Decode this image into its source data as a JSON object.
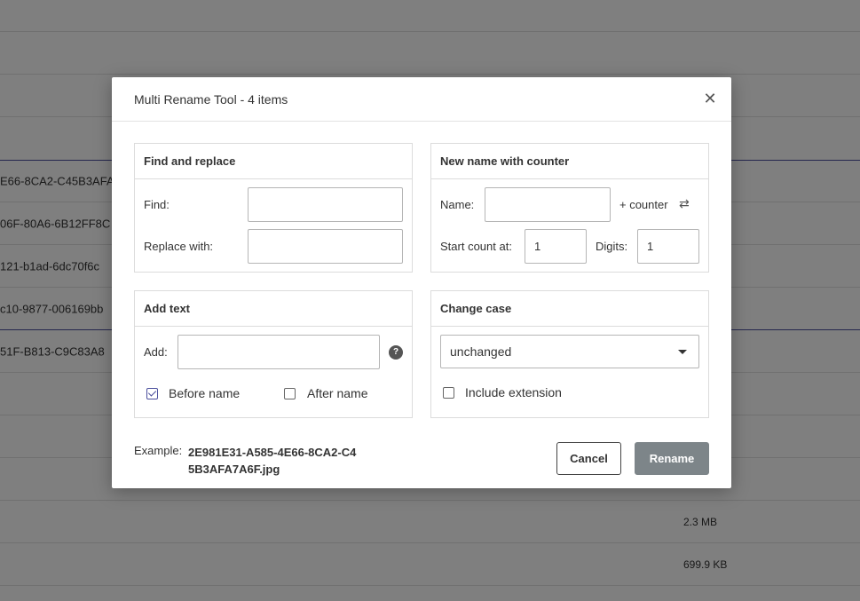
{
  "background": {
    "rows": [
      {
        "name": "",
        "size": ""
      },
      {
        "name": "",
        "size": ""
      },
      {
        "name": "",
        "size": ""
      },
      {
        "name": "E66-8CA2-C45B3AFA",
        "size": ""
      },
      {
        "name": "06F-80A6-6B12FF8C",
        "size": ""
      },
      {
        "name": "121-b1ad-6dc70f6c",
        "size": ""
      },
      {
        "name": "c10-9877-006169bb",
        "size": ""
      },
      {
        "name": "51F-B813-C9C83A8",
        "size": ""
      },
      {
        "name": "",
        "size": ""
      },
      {
        "name": "",
        "size": ""
      },
      {
        "name": "",
        "size": ""
      },
      {
        "name": "",
        "size": "2.3 MB"
      },
      {
        "name": "",
        "size": "699.9 KB"
      }
    ]
  },
  "dialog": {
    "title": "Multi Rename Tool - 4 items",
    "close_icon": "close-icon",
    "find_replace": {
      "heading": "Find and replace",
      "find_label": "Find:",
      "find_value": "",
      "replace_label": "Replace with:",
      "replace_value": ""
    },
    "counter": {
      "heading": "New name with counter",
      "name_label": "Name:",
      "name_value": "",
      "counter_label": "+ counter",
      "swap_icon": "swap-icon",
      "start_label": "Start count at:",
      "start_value": "1",
      "digits_label": "Digits:",
      "digits_value": "1"
    },
    "add_text": {
      "heading": "Add text",
      "add_label": "Add:",
      "add_value": "",
      "help_icon": "?",
      "before_label": "Before name",
      "before_checked": true,
      "after_label": "After name",
      "after_checked": false
    },
    "change_case": {
      "heading": "Change case",
      "selected": "unchanged",
      "include_ext_label": "Include extension",
      "include_ext_checked": false
    },
    "example": {
      "label": "Example:",
      "value": "2E981E31-A585-4E66-8CA2-C45B3AFA7A6F.jpg"
    },
    "buttons": {
      "cancel": "Cancel",
      "rename": "Rename"
    }
  }
}
